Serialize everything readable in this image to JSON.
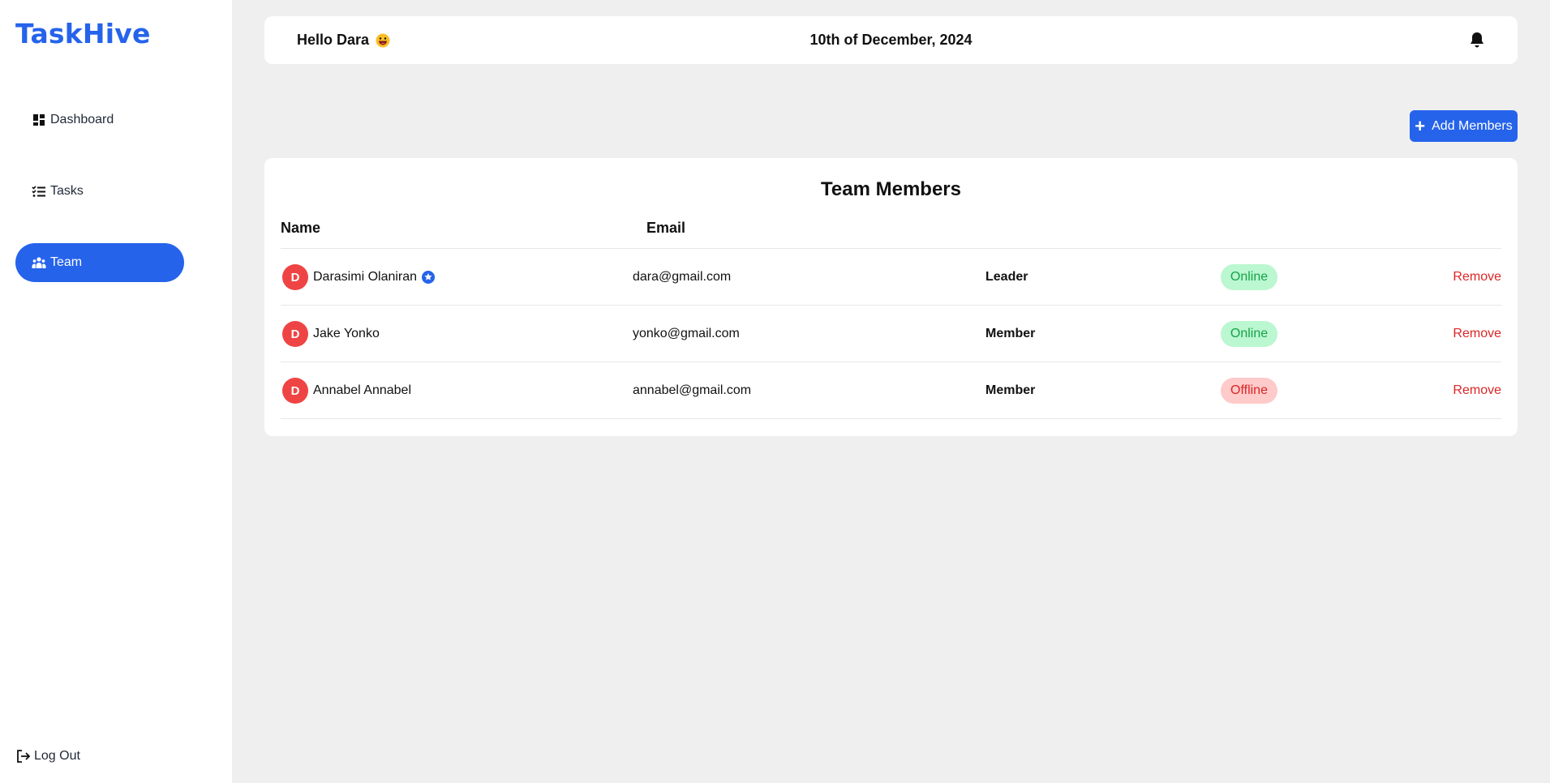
{
  "app": {
    "logo": "TaskHive"
  },
  "sidebar": {
    "items": [
      {
        "label": "Dashboard",
        "icon": "dashboard-icon",
        "active": false
      },
      {
        "label": "Tasks",
        "icon": "task-list-icon",
        "active": false
      },
      {
        "label": "Team",
        "icon": "team-icon",
        "active": true
      }
    ],
    "logout_label": "Log Out"
  },
  "header": {
    "greeting": "Hello Dara",
    "date": "10th of December, 2024",
    "notification_icon": "bell-icon"
  },
  "actions": {
    "add_members_label": "Add Members"
  },
  "team": {
    "title": "Team Members",
    "columns": {
      "name": "Name",
      "email": "Email"
    },
    "members": [
      {
        "initial": "D",
        "name": "Darasimi Olaniran",
        "email": "dara@gmail.com",
        "role": "Leader",
        "status": "Online",
        "remove_label": "Remove",
        "leader_badge": true
      },
      {
        "initial": "D",
        "name": "Jake Yonko",
        "email": "yonko@gmail.com",
        "role": "Member",
        "status": "Online",
        "remove_label": "Remove",
        "leader_badge": false
      },
      {
        "initial": "D",
        "name": "Annabel Annabel",
        "email": "annabel@gmail.com",
        "role": "Member",
        "status": "Offline",
        "remove_label": "Remove",
        "leader_badge": false
      }
    ]
  },
  "colors": {
    "accent": "#2563eb",
    "avatar": "#ef4444",
    "online_bg": "#bbf7d0",
    "online_text": "#16a34a",
    "offline_bg": "#fecaca",
    "offline_text": "#dc2626"
  }
}
